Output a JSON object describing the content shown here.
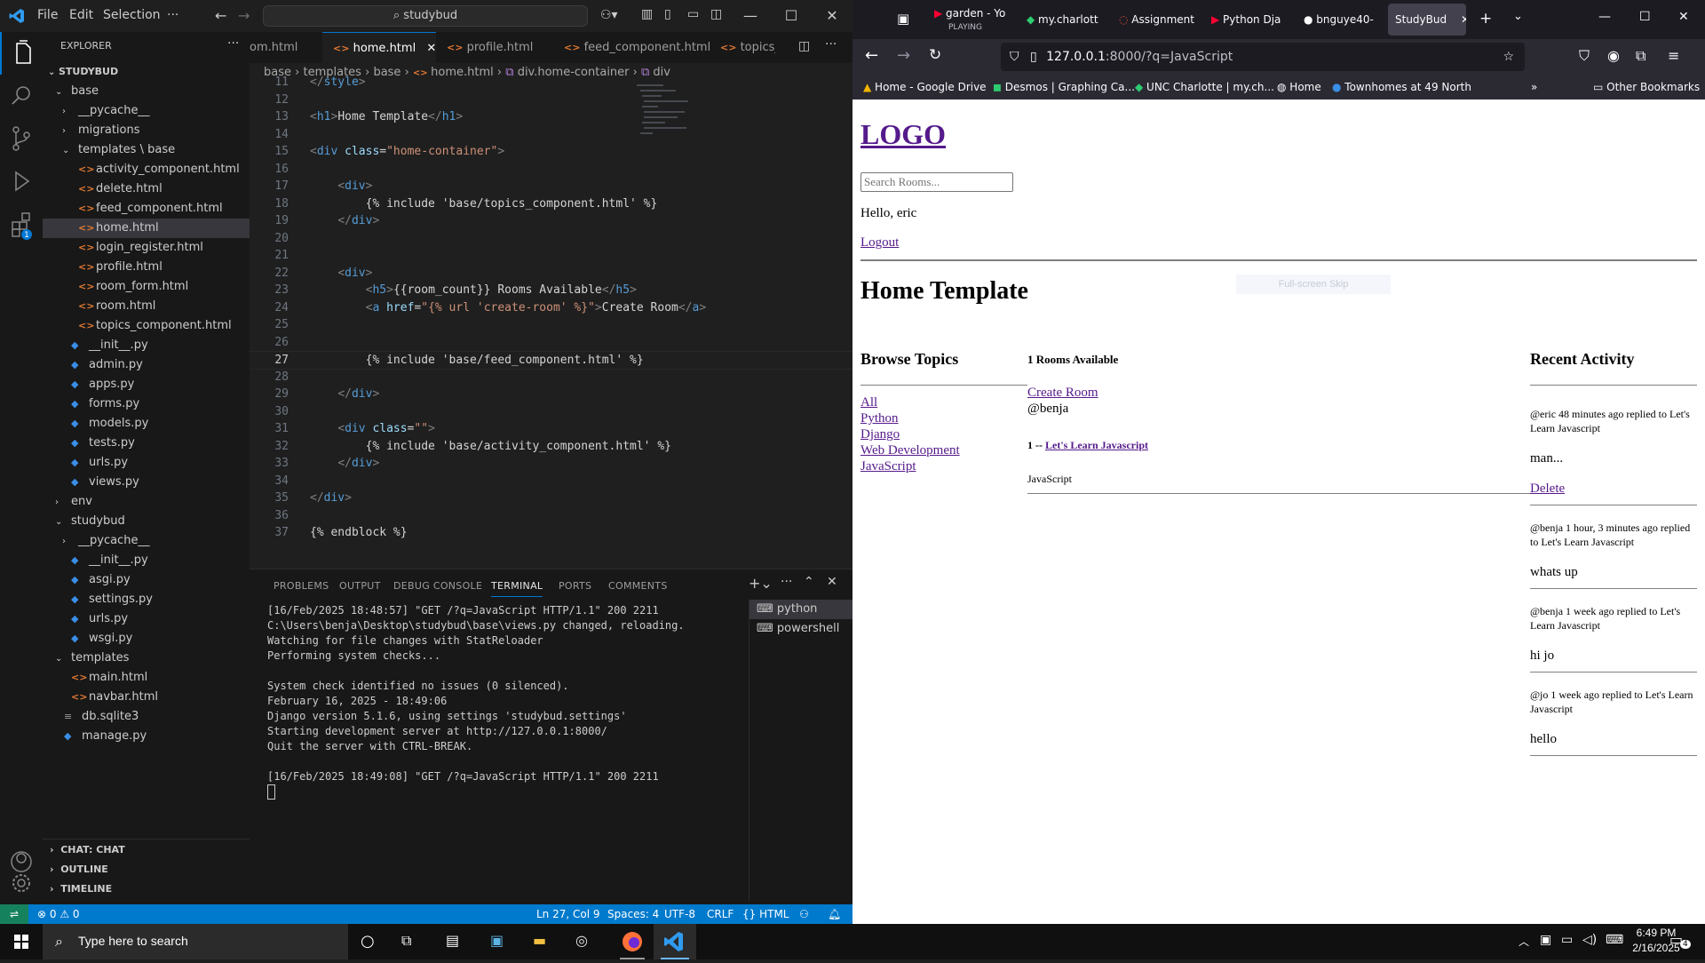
{
  "vscode": {
    "menu": [
      "File",
      "Edit",
      "Selection",
      "···"
    ],
    "search": "studybud",
    "explorer": {
      "title": "EXPLORER",
      "root": "STUDYBUD",
      "tree": [
        {
          "label": "base",
          "depth": 1,
          "type": "folder-open"
        },
        {
          "label": "__pycache__",
          "depth": 2,
          "type": "folder"
        },
        {
          "label": "migrations",
          "depth": 2,
          "type": "folder"
        },
        {
          "label": "templates \\ base",
          "depth": 2,
          "type": "folder-open"
        },
        {
          "label": "activity_component.html",
          "depth": 3,
          "type": "html"
        },
        {
          "label": "delete.html",
          "depth": 3,
          "type": "html"
        },
        {
          "label": "feed_component.html",
          "depth": 3,
          "type": "html"
        },
        {
          "label": "home.html",
          "depth": 3,
          "type": "html",
          "selected": true
        },
        {
          "label": "login_register.html",
          "depth": 3,
          "type": "html"
        },
        {
          "label": "profile.html",
          "depth": 3,
          "type": "html"
        },
        {
          "label": "room_form.html",
          "depth": 3,
          "type": "html"
        },
        {
          "label": "room.html",
          "depth": 3,
          "type": "html"
        },
        {
          "label": "topics_component.html",
          "depth": 3,
          "type": "html"
        },
        {
          "label": "__init__.py",
          "depth": 2,
          "type": "py"
        },
        {
          "label": "admin.py",
          "depth": 2,
          "type": "py"
        },
        {
          "label": "apps.py",
          "depth": 2,
          "type": "py"
        },
        {
          "label": "forms.py",
          "depth": 2,
          "type": "py"
        },
        {
          "label": "models.py",
          "depth": 2,
          "type": "py"
        },
        {
          "label": "tests.py",
          "depth": 2,
          "type": "py"
        },
        {
          "label": "urls.py",
          "depth": 2,
          "type": "py"
        },
        {
          "label": "views.py",
          "depth": 2,
          "type": "py"
        },
        {
          "label": "env",
          "depth": 1,
          "type": "folder"
        },
        {
          "label": "studybud",
          "depth": 1,
          "type": "folder-open"
        },
        {
          "label": "__pycache__",
          "depth": 2,
          "type": "folder"
        },
        {
          "label": "__init__.py",
          "depth": 2,
          "type": "py"
        },
        {
          "label": "asgi.py",
          "depth": 2,
          "type": "py"
        },
        {
          "label": "settings.py",
          "depth": 2,
          "type": "py"
        },
        {
          "label": "urls.py",
          "depth": 2,
          "type": "py"
        },
        {
          "label": "wsgi.py",
          "depth": 2,
          "type": "py"
        },
        {
          "label": "templates",
          "depth": 1,
          "type": "folder-open"
        },
        {
          "label": "main.html",
          "depth": 2,
          "type": "html"
        },
        {
          "label": "navbar.html",
          "depth": 2,
          "type": "html"
        },
        {
          "label": "db.sqlite3",
          "depth": 1,
          "type": "db"
        },
        {
          "label": "manage.py",
          "depth": 1,
          "type": "py"
        }
      ],
      "bottom_sections": [
        "CHAT: CHAT",
        "OUTLINE",
        "TIMELINE"
      ]
    },
    "tabs": [
      {
        "label": "om.html",
        "active": false
      },
      {
        "label": "home.html",
        "active": true
      },
      {
        "label": "profile.html",
        "active": false
      },
      {
        "label": "feed_component.html",
        "active": false
      },
      {
        "label": "topics_c",
        "active": false
      }
    ],
    "breadcrumb": [
      "base",
      "templates",
      "base",
      "home.html",
      "div.home-container",
      "div"
    ],
    "code_lines": [
      {
        "n": "11",
        "t": "</style>"
      },
      {
        "n": "12",
        "t": ""
      },
      {
        "n": "13",
        "t": "<h1>Home Template</h1>"
      },
      {
        "n": "14",
        "t": ""
      },
      {
        "n": "15",
        "t": "<div class=\"home-container\">"
      },
      {
        "n": "16",
        "t": ""
      },
      {
        "n": "17",
        "t": "    <div>"
      },
      {
        "n": "18",
        "t": "        {% include 'base/topics_component.html' %}"
      },
      {
        "n": "19",
        "t": "    </div>"
      },
      {
        "n": "20",
        "t": ""
      },
      {
        "n": "21",
        "t": ""
      },
      {
        "n": "22",
        "t": "    <div>"
      },
      {
        "n": "23",
        "t": "        <h5>{{room_count}} Rooms Available</h5>"
      },
      {
        "n": "24",
        "t": "        <a href=\"{% url 'create-room' %}\">Create Room</a>"
      },
      {
        "n": "25",
        "t": ""
      },
      {
        "n": "26",
        "t": ""
      },
      {
        "n": "27",
        "t": "        {% include 'base/feed_component.html' %}"
      },
      {
        "n": "28",
        "t": ""
      },
      {
        "n": "29",
        "t": "    </div>"
      },
      {
        "n": "30",
        "t": ""
      },
      {
        "n": "31",
        "t": "    <div class=\"\">"
      },
      {
        "n": "32",
        "t": "        {% include 'base/activity_component.html' %}"
      },
      {
        "n": "33",
        "t": "    </div>"
      },
      {
        "n": "34",
        "t": ""
      },
      {
        "n": "35",
        "t": "</div>"
      },
      {
        "n": "36",
        "t": ""
      },
      {
        "n": "37",
        "t": "{% endblock %}"
      }
    ],
    "panel_tabs": [
      "PROBLEMS",
      "OUTPUT",
      "DEBUG CONSOLE",
      "TERMINAL",
      "PORTS",
      "COMMENTS"
    ],
    "terminal_lines": [
      "[16/Feb/2025 18:48:57] \"GET /?q=JavaScript HTTP/1.1\" 200 2211",
      "C:\\Users\\benja\\Desktop\\studybud\\base\\views.py changed, reloading.",
      "Watching for file changes with StatReloader",
      "Performing system checks...",
      "",
      "System check identified no issues (0 silenced).",
      "February 16, 2025 - 18:49:06",
      "Django version 5.1.6, using settings 'studybud.settings'",
      "Starting development server at http://127.0.0.1:8000/",
      "Quit the server with CTRL-BREAK.",
      "",
      "[16/Feb/2025 18:49:08] \"GET /?q=JavaScript HTTP/1.1\" 200 2211"
    ],
    "terminals": [
      "python",
      "powershell"
    ],
    "status": {
      "errors": "0",
      "warnings": "0",
      "position": "Ln 27, Col 9",
      "spaces": "Spaces: 4",
      "encoding": "UTF-8",
      "eol": "CRLF",
      "language": "HTML"
    }
  },
  "firefox": {
    "tabs": [
      {
        "label": "garden - Yo",
        "sub": "PLAYING"
      },
      {
        "label": "my.charlott"
      },
      {
        "label": "Assignment"
      },
      {
        "label": "Python Dja"
      },
      {
        "label": "bnguye40-"
      },
      {
        "label": "StudyBud",
        "active": true
      }
    ],
    "url_host": "127.0.0.1",
    "url_rest": ":8000/?q=JavaScript",
    "bookmarks": [
      "Home - Google Drive",
      "Desmos | Graphing Ca...",
      "UNC Charlotte | my.ch...",
      "Home",
      "Townhomes at 49 North"
    ],
    "other_bookmarks": "Other Bookmarks",
    "page": {
      "logo": "LOGO",
      "search_placeholder": "Search Rooms...",
      "hello": "Hello, eric",
      "logout": "Logout",
      "heading": "Home Template",
      "skip_hint": "Full-screen Skip",
      "browse_topics": "Browse Topics",
      "topics": [
        "All",
        "Python",
        "Django",
        "Web Development",
        "JavaScript"
      ],
      "rooms_available": "1 Rooms Available",
      "create_room": "Create Room",
      "feed": {
        "host": "@benja",
        "room_prefix": "1 --",
        "room_title": "Let's Learn Javascript",
        "topic": "JavaScript"
      },
      "recent_activity_title": "Recent Activity",
      "activities": [
        {
          "meta": "@eric 48 minutes ago replied to Let's Learn Javascript",
          "body": "man...",
          "delete": "Delete"
        },
        {
          "meta": "@benja 1 hour, 3 minutes ago replied to Let's Learn Javascript",
          "body": "whats up"
        },
        {
          "meta": "@benja 1 week ago replied to Let's Learn Javascript",
          "body": "hi jo"
        },
        {
          "meta": "@jo 1 week ago replied to Let's Learn Javascript",
          "body": "hello"
        }
      ]
    }
  },
  "taskbar": {
    "search_placeholder": "Type here to search",
    "time": "6:49 PM",
    "date": "2/16/2025",
    "notifications": "4"
  },
  "colors": {
    "vscode_accent": "#0078d4",
    "statusbar": "#007acc",
    "visited_link": "#551a8b"
  }
}
